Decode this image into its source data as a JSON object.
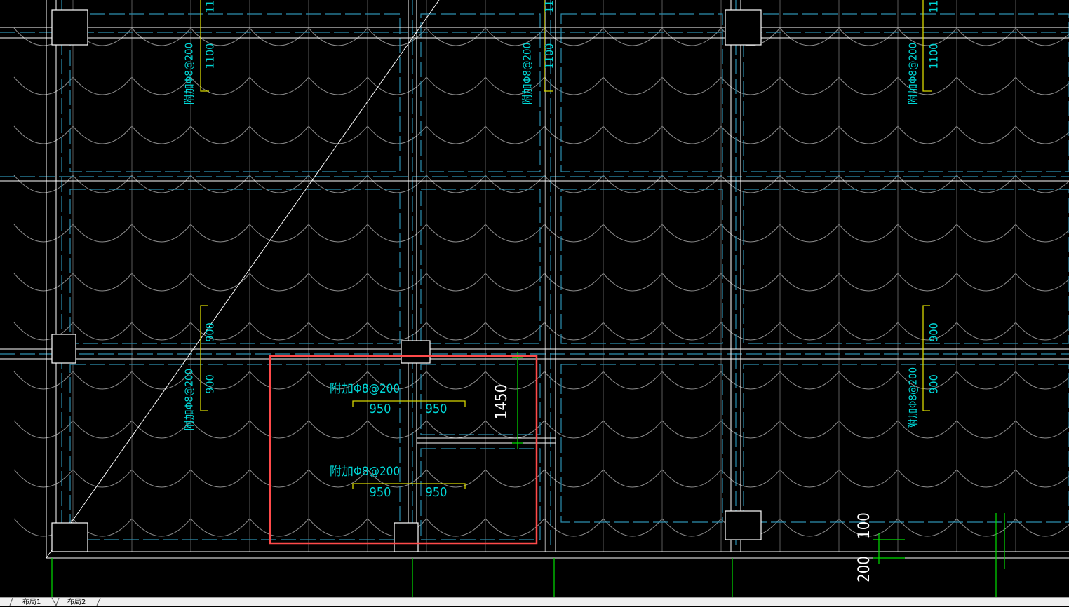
{
  "drawing": {
    "colors": {
      "background": "#000000",
      "grid": "#ffffff",
      "rebar_dash": "#2c8fb0",
      "arc": "#8a8a8a",
      "rebar_text": "#00d8d8",
      "bracket": "#d8d800",
      "dimension": "#00e000",
      "highlight": "#ff4a4a"
    },
    "annotations": {
      "rebar_note": "附加Φ8@200",
      "dim_1100": "1100",
      "dim_900": "900",
      "dim_950": "950",
      "dim_1450": "1450",
      "dim_100": "100",
      "dim_200": "200"
    }
  },
  "layout_tabs": [
    "布局1",
    "布局2"
  ]
}
